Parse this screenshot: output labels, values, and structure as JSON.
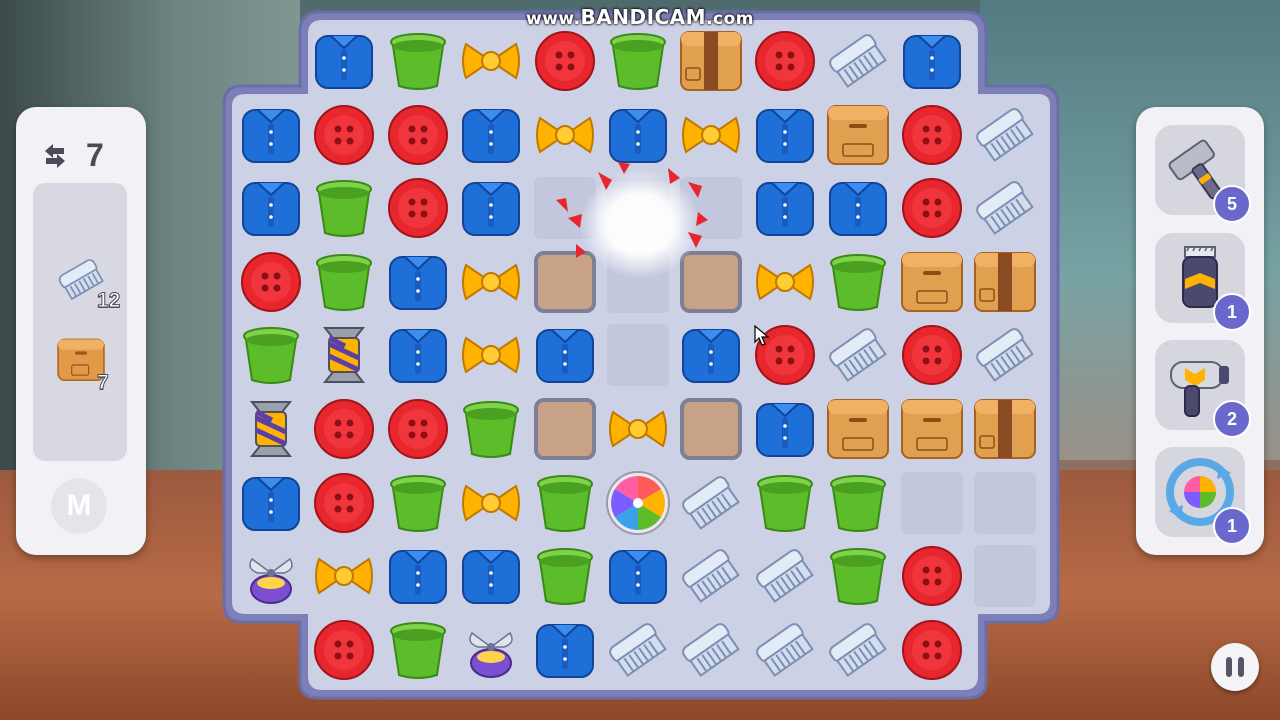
{
  "watermark": {
    "prefix": "www.",
    "brand": "BANDICAM",
    "suffix": ".com"
  },
  "moves": {
    "icon": "swap-arrows-icon",
    "count": "7"
  },
  "goals": [
    {
      "icon": "comb-icon",
      "count": "12"
    },
    {
      "icon": "cardboard-box-icon",
      "count": "7"
    }
  ],
  "level_badge": "M",
  "boosters": [
    {
      "name": "hammer",
      "icon": "hammer-icon",
      "count": "5"
    },
    {
      "name": "hair-clipper",
      "icon": "hair-clipper-icon",
      "count": "1"
    },
    {
      "name": "hair-dryer",
      "icon": "hair-dryer-icon",
      "count": "2"
    },
    {
      "name": "shuffle",
      "icon": "shuffle-icon",
      "count": "1"
    }
  ],
  "pause_icon": "pause-icon",
  "colors": {
    "button": "#e8262d",
    "shirt": "#1f6fd8",
    "cup": "#5cbc2a",
    "bow": "#ffb300",
    "comb": "#e3ebf7",
    "box": "#e0a050",
    "board": "#cfd3e8",
    "booster_badge": "#6a68cc"
  },
  "board": {
    "columns": 11,
    "rows": 9,
    "legend": {
      "R": "red-button",
      "B": "blue-shirt",
      "G": "green-cup",
      "Y": "yellow-bow",
      "C": "white-comb",
      "X": "cardboard-box",
      "T": "taped-box",
      "P": "propeller",
      "V": "vertical-rocket",
      "O": "rainbow-candy",
      "S": "empty-slot",
      "E": "empty-cell",
      "N": "blocked"
    },
    "grid": [
      "NBGYRGTRCBN",
      "BRRBYBYBXRC",
      "BGRBEEEBBRC",
      "RGBYSESYGXT",
      "GVBYBEBRCRC",
      "VRRGSYSBXXT",
      "BRGYGOCGGEE",
      "PYBBGBCCGRE",
      "NRGPBCCCCRN"
    ]
  }
}
